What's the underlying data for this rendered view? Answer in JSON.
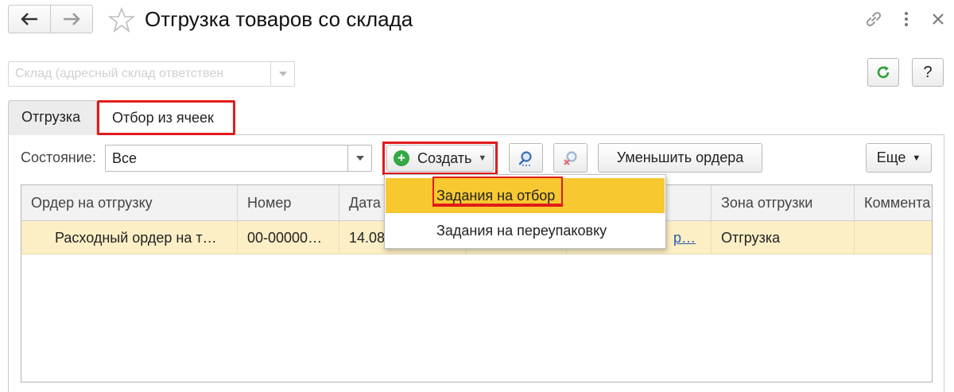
{
  "window": {
    "title": "Отгрузка товаров со склада",
    "nav_back_icon": "arrow-left-icon",
    "nav_forward_icon": "arrow-right-icon",
    "favorite_icon": "star-icon",
    "link_icon": "link-icon",
    "menu_icon": "more-vertical-icon",
    "close_icon": "close-icon"
  },
  "toolbar_top": {
    "warehouse_placeholder": "Склад (адресный склад ответствен",
    "refresh_icon": "refresh-icon",
    "help_label": "?"
  },
  "tabs": [
    {
      "label": "Отгрузка",
      "active": false
    },
    {
      "label": "Отбор из ячеек",
      "active": true
    }
  ],
  "filter": {
    "state_label": "Состояние:",
    "state_value": "Все",
    "create_label": "Создать",
    "search_icon": "search-icon",
    "clear_search_icon": "clear-search-icon",
    "reduce_orders_label": "Уменьшить ордера",
    "more_label": "Еще"
  },
  "create_menu": {
    "items": [
      {
        "label": "Задания на отбор",
        "highlighted": true
      },
      {
        "label": "Задания на переупаковку",
        "highlighted": false
      }
    ]
  },
  "table": {
    "columns": [
      "Ордер на отгрузку",
      "Номер",
      "Дата",
      "",
      "",
      "Зона отгрузки",
      "Коммента"
    ],
    "rows": [
      {
        "order": "Расходный ордер на т…",
        "number": "00-00000…",
        "date": "14.08",
        "col4": "",
        "col5": "р…",
        "zone": "Отгрузка",
        "comment": ""
      }
    ]
  },
  "colors": {
    "accent_highlight": "#f7c830",
    "selected_row": "#fcefc5",
    "annotation_red": "#e01b1b",
    "create_green": "#33a845",
    "refresh_green": "#2fa13b"
  }
}
